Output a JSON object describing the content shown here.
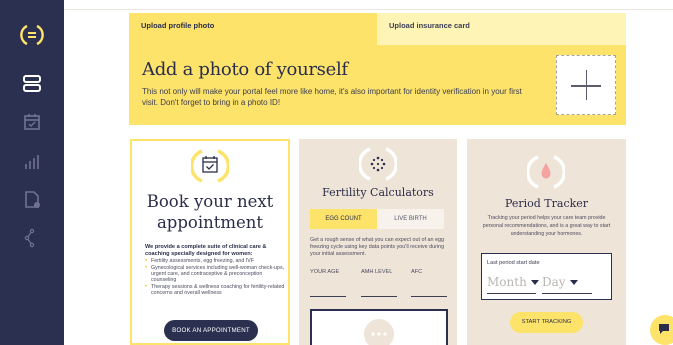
{
  "sidebar": {
    "icons": [
      "menu-logo-icon",
      "dashboard-icon",
      "calendar-icon",
      "chart-icon",
      "document-icon",
      "network-icon"
    ],
    "active_index": 1
  },
  "tabs": {
    "profile": "Upload profile photo",
    "insurance": "Upload insurance card"
  },
  "banner": {
    "title": "Add a photo of yourself",
    "description": "This not only will make your portal feel more like home, it's also important for identity verification in your first visit. Don't forget to bring in a photo ID!"
  },
  "appointment": {
    "title": "Book your next appointment",
    "intro": "We provide a complete suite of clinical care & coaching specially designed for women:",
    "items": [
      "Fertility assessments, egg freezing, and IVF",
      "Gynecological services including well-woman check-ups, urgent care, and contraceptive & preconception counseling",
      "Therapy sessions & wellness coaching for fertility-related concerns and overall wellness"
    ],
    "button": "BOOK AN APPOINTMENT"
  },
  "fertility": {
    "title": "Fertility Calculators",
    "tabs": [
      "EGG COUNT",
      "LIVE BIRTH"
    ],
    "description": "Get a rough sense of what you can expect out of an egg freezing cycle using key data points you'll receive during your initial assessment.",
    "fields": [
      "YOUR AGE",
      "AMH LEVEL",
      "AFC"
    ]
  },
  "period": {
    "title": "Period Tracker",
    "description": "Tracking your period helps your care team provide personal recommendations, and is a great way to start understanding your hormones.",
    "label": "Last period start date",
    "month_placeholder": "Month",
    "day_placeholder": "Day",
    "button": "START TRACKING"
  },
  "colors": {
    "sidebar": "#2b3050",
    "accent_yellow": "#fde36a",
    "card_beige": "#efe4d8",
    "period_drop": "#f5a3a0"
  }
}
